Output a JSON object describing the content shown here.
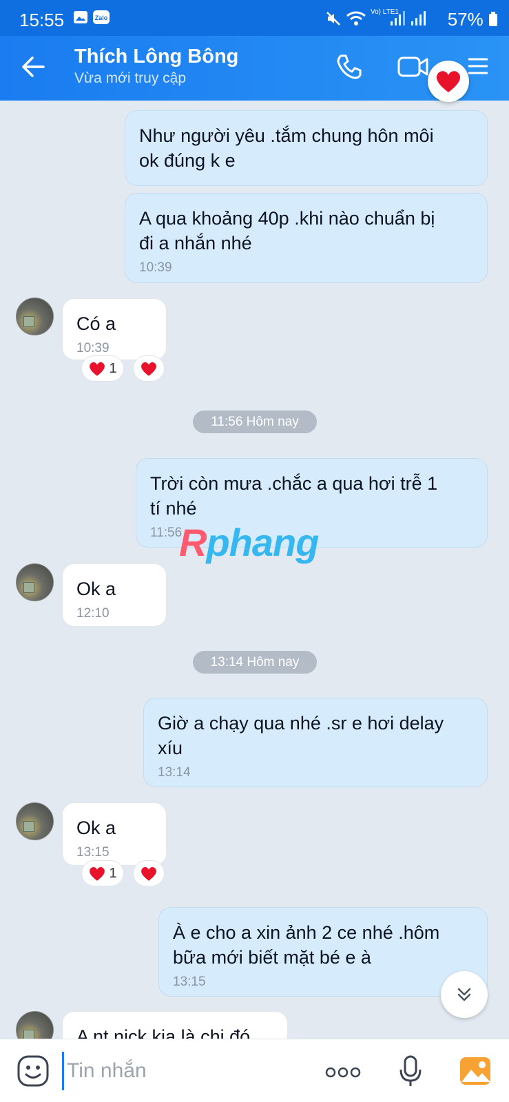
{
  "status": {
    "time": "15:55",
    "battery": "57%",
    "network_label": "Vo) LTE1"
  },
  "header": {
    "contact_name": "Thích Lông Bông",
    "presence": "Vừa mới truy cập"
  },
  "messages": [
    {
      "dir": "out",
      "text_lines": [
        "Như người yêu .tắm chung hôn môi",
        "ok đúng k e"
      ],
      "time": ""
    },
    {
      "dir": "out",
      "text_lines": [
        "A qua khoảng 40p .khi nào chuẩn bị",
        "đi a nhắn nhé"
      ],
      "time": "10:39"
    },
    {
      "dir": "in",
      "text_lines": [
        "Có a"
      ],
      "time": "10:39",
      "reaction_count": "1"
    },
    {
      "dir": "out",
      "text_lines": [
        "Trời còn mưa .chắc a qua hơi trễ 1",
        "tí nhé"
      ],
      "time": "11:56"
    },
    {
      "dir": "in",
      "text_lines": [
        "Ok a"
      ],
      "time": "12:10"
    },
    {
      "dir": "out",
      "text_lines": [
        "Giờ a chạy qua nhé .sr e hơi delay",
        "xíu"
      ],
      "time": "13:14"
    },
    {
      "dir": "in",
      "text_lines": [
        "Ok a"
      ],
      "time": "13:15",
      "reaction_count": "1"
    },
    {
      "dir": "out",
      "text_lines": [
        "À e cho a xin ảnh 2 ce nhé .hôm",
        "bữa mới biết mặt bé e à"
      ],
      "time": "13:15"
    },
    {
      "dir": "in",
      "text_lines": [
        "A nt nick kia là chị đó"
      ],
      "time": ""
    }
  ],
  "separators": [
    "11:56 Hôm nay",
    "13:14 Hôm nay"
  ],
  "watermark": {
    "first": "R",
    "rest": "phang"
  },
  "composer": {
    "placeholder": "Tin nhắn"
  },
  "colors": {
    "header": "#1a7cf0",
    "outgoing_bubble": "#d6ecfd",
    "incoming_bubble": "#ffffff",
    "background": "#e2e9f1",
    "heart": "#e8132b"
  },
  "icons": [
    "back-arrow-icon",
    "phone-icon",
    "video-call-icon",
    "menu-icon",
    "heart-icon",
    "chevron-down-icon",
    "emoji-icon",
    "more-icon",
    "mic-icon",
    "image-icon"
  ]
}
